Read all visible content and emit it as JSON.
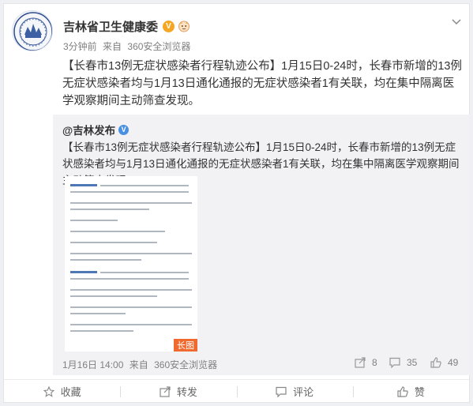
{
  "post": {
    "author": "吉林省卫生健康委",
    "time": "3分钟前",
    "source_prefix": "来自",
    "source": "360安全浏览器",
    "text": "【长春市13例无症状感染者行程轨迹公布】1月15日0-24时，长春市新增的13例无症状感染者均与1月13日通化通报的无症状感染者1有关联，均在集中隔离医学观察期间主动筛查发现。"
  },
  "repost": {
    "author": "@吉林发布",
    "text": "【长春市13例无症状感染者行程轨迹公布】1月15日0-24时，长春市新增的13例无症状感染者均与1月13日通化通报的无症状感染者1有关联，均在集中隔离医学观察期间主动筛查发现。",
    "image_tag": "长图",
    "date": "1月16日 14:00",
    "source_prefix": "来自",
    "source": "360安全浏览器",
    "shares": "8",
    "comments": "35",
    "likes": "49"
  },
  "actions": {
    "favorite": "收藏",
    "repost": "转发",
    "comment": "评论",
    "like": "赞"
  },
  "colors": {
    "badge_gold": "#f5a623",
    "badge_blue": "#4a90e2",
    "image_tag": "#f0692f"
  },
  "icons": [
    "emblem-logo-icon",
    "verified-badge-icon",
    "member-icon",
    "chevron-down-icon",
    "share-icon",
    "comment-icon",
    "like-icon",
    "star-icon"
  ]
}
